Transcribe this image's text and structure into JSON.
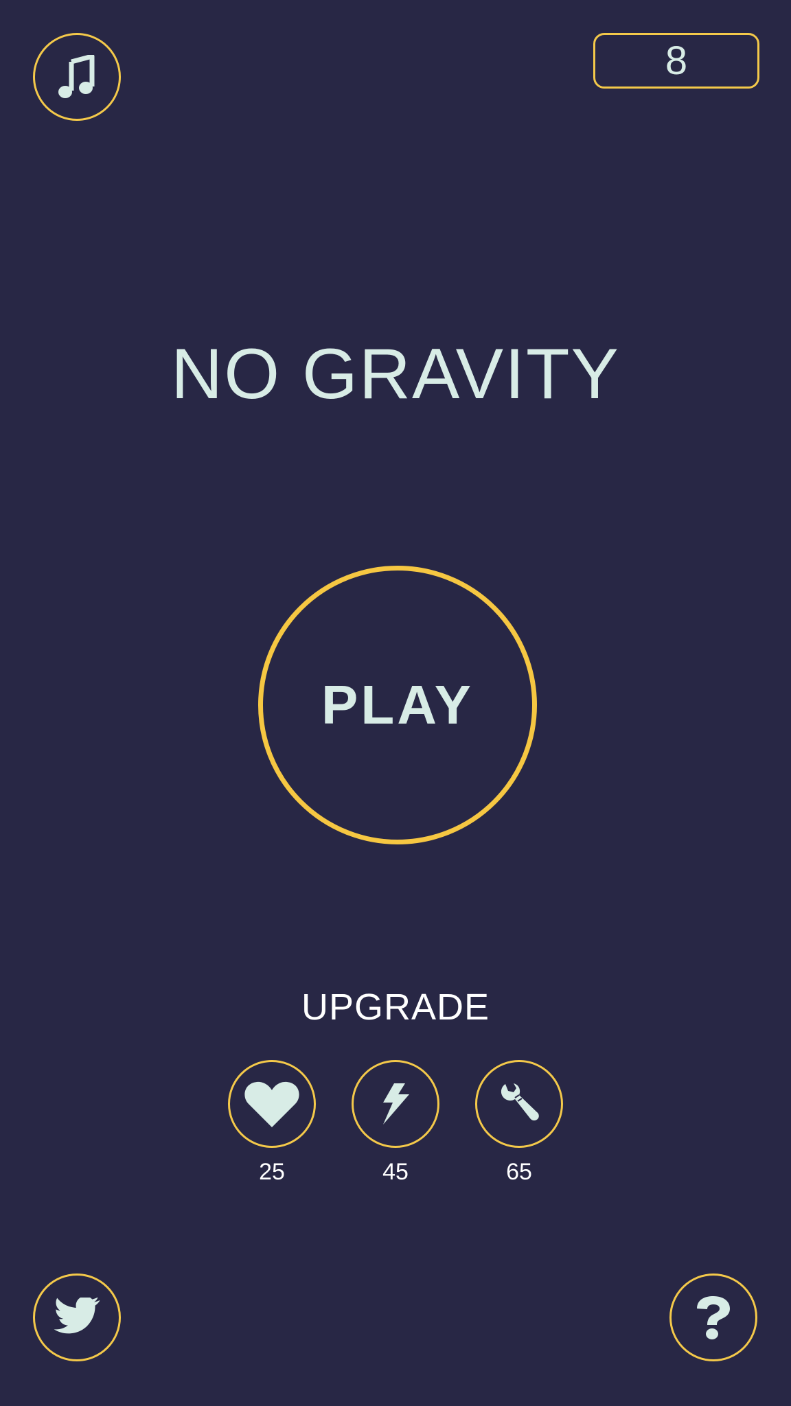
{
  "game": {
    "title": "NO GRAVITY",
    "score": "8",
    "play_label": "PLAY",
    "upgrade_label": "UPGRADE"
  },
  "upgrades": [
    {
      "name": "health",
      "icon": "heart-icon",
      "cost": "25"
    },
    {
      "name": "speed",
      "icon": "lightning-icon",
      "cost": "45"
    },
    {
      "name": "repair",
      "icon": "wrench-icon",
      "cost": "65"
    }
  ],
  "buttons": {
    "music_icon": "music-note-icon",
    "twitter_icon": "twitter-bird-icon",
    "help_icon": "question-mark-icon"
  },
  "colors": {
    "background": "#282745",
    "accent": "#f4c94a",
    "text": "#d8ece6"
  }
}
